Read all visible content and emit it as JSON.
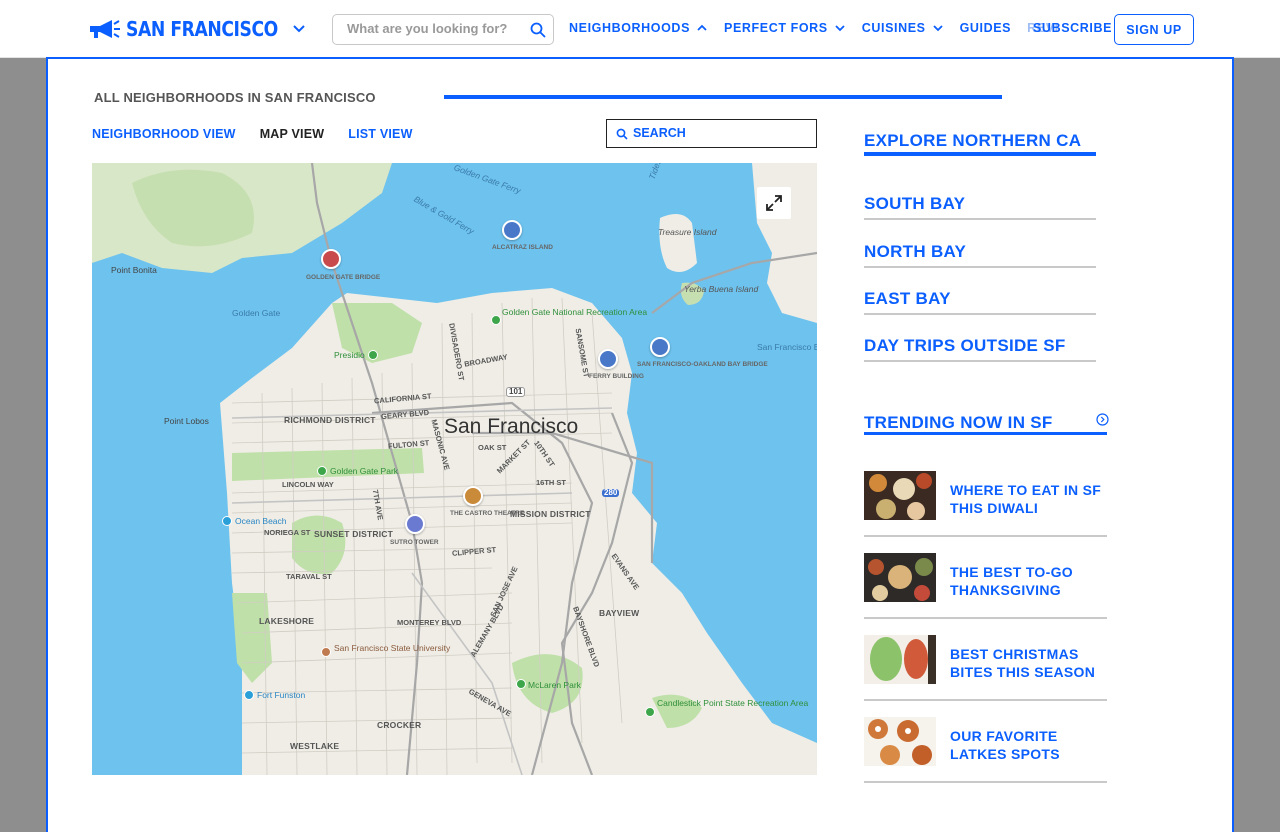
{
  "header": {
    "city_name": "SAN FRANCISCO",
    "logo_icon": "megaphone-icon",
    "search_placeholder": "What are you looking for?",
    "nav": [
      {
        "label": "NEIGHBORHOODS",
        "chevron": "up"
      },
      {
        "label": "PERFECT FORS",
        "chevron": "down"
      },
      {
        "label": "CUISINES",
        "chevron": "down"
      },
      {
        "label": "GUIDES"
      },
      {
        "label": "REVI"
      }
    ],
    "subscribe_label": "SUBSCRIBE",
    "signup_label": "SIGN UP"
  },
  "panel": {
    "title": "ALL NEIGHBORHOODS IN SAN FRANCISCO",
    "view_tabs": [
      "NEIGHBORHOOD VIEW",
      "MAP VIEW",
      "LIST VIEW"
    ],
    "active_view": "MAP VIEW",
    "map_search_placeholder": "SEARCH"
  },
  "map": {
    "city_label": "San Francisco",
    "labels": {
      "golden_gate_ferry": "Golden Gate Ferry",
      "blue_gold_ferry": "Blue & Gold Ferry",
      "alcatraz": "ALCATRAZ ISLAND",
      "treasure_island": "Treasure Island",
      "yerba_buena": "Yerba Buena Island",
      "point_bonita": "Point Bonita",
      "golden_gate": "Golden Gate",
      "golden_gate_bridge": "GOLDEN GATE BRIDGE",
      "golden_gate_nra": "Golden Gate National Recreation Area",
      "presidio": "Presidio",
      "divisadero": "DIVISADERO ST",
      "broadway": "BROADWAY",
      "sansome": "SANSOME ST",
      "ferry_building": "FERRY BUILDING",
      "bay_bridge": "SAN FRANCISCO-OAKLAND BAY BRIDGE",
      "sf_bay": "San Francisco B",
      "hwy101": "101",
      "california": "CALIFORNIA ST",
      "point_lobos": "Point Lobos",
      "geary": "GEARY BLVD",
      "richmond": "RICHMOND DISTRICT",
      "fulton": "FULTON ST",
      "masonic": "MASONIC AVE",
      "oak": "OAK ST",
      "market": "MARKET ST",
      "tenth": "10TH ST",
      "ggpark": "Golden Gate Park",
      "sixteenth": "16TH ST",
      "hwy280": "280",
      "lincoln": "LINCOLN WAY",
      "seventh": "7TH AVE",
      "castro": "THE CASTRO THEATRE",
      "mission": "MISSION DISTRICT",
      "ocean_beach": "Ocean Beach",
      "noriega": "NORIEGA ST",
      "sunset": "SUNSET DISTRICT",
      "sutro": "SUTRO TOWER",
      "clipper": "CLIPPER ST",
      "evans": "EVANS AVE",
      "taraval": "TARAVAL ST",
      "san_jose": "SAN JOSE AVE",
      "bayview": "BAYVIEW",
      "lakeshore": "LAKESHORE",
      "monterey": "MONTEREY BLVD",
      "alemany": "ALEMANY BLVD",
      "bayshore": "BAYSHORE BLVD",
      "sfsu": "San Francisco State University",
      "mclaren": "McLaren Park",
      "fort_funston": "Fort Funston",
      "geneva": "GENEVA AVE",
      "candlestick": "Candlestick Point State Recreation Area",
      "crocker": "CROCKER",
      "westlake": "WESTLAKE",
      "tides": "Tides"
    },
    "expand_icon": "expand-icon"
  },
  "sidebar": {
    "explore_heading": "EXPLORE NORTHERN CA",
    "regions": [
      "SOUTH BAY",
      "NORTH BAY",
      "EAST BAY",
      "DAY TRIPS OUTSIDE SF"
    ],
    "trending_heading": "TRENDING NOW IN SF",
    "trending_icon": "chevron-right-circle-icon",
    "articles": [
      {
        "title": "WHERE TO EAT IN SF THIS DIWALI"
      },
      {
        "title": "THE BEST TO-GO THANKSGIVING"
      },
      {
        "title": "BEST CHRISTMAS BITES THIS SEASON"
      },
      {
        "title": "OUR FAVORITE LATKES SPOTS"
      }
    ]
  },
  "colors": {
    "brand_blue": "#0b5fff",
    "water": "#6ec2ee",
    "land": "#efede6",
    "park": "#bfe0a8"
  }
}
